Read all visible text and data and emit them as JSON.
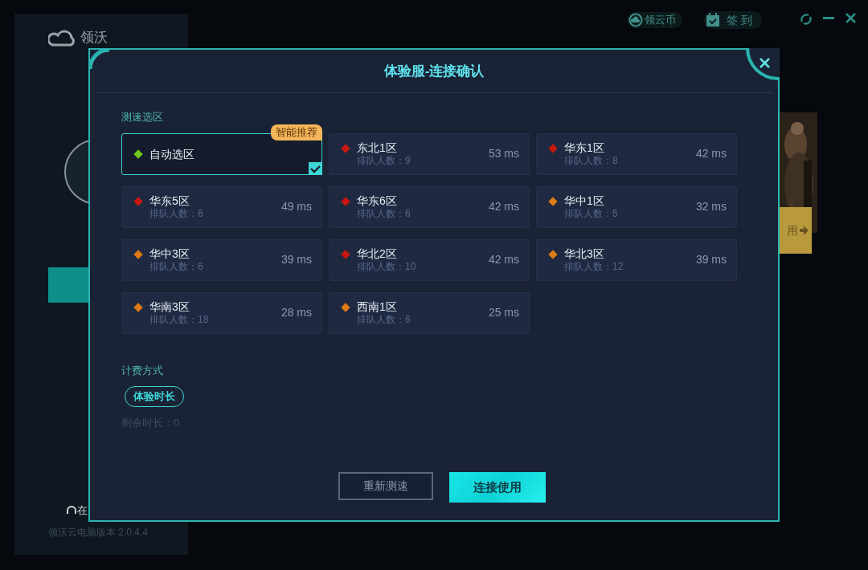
{
  "app": {
    "logo": "领沃",
    "coin_button": "领云币",
    "checkin_button": "签 到",
    "side_button": "用",
    "support_text": "在",
    "version": "领沃云电脑版本 2.0.4.4"
  },
  "dialog": {
    "title": "体验服-连接确认",
    "region_label": "测速选区",
    "regions": [
      {
        "name": "自动选区",
        "color": "#6fc51a",
        "selected": true,
        "badge": "智能推荐"
      },
      {
        "name": "东北1区",
        "queue": "排队人数：9",
        "latency": "53 ms",
        "color": "#c8180e",
        "selected": false
      },
      {
        "name": "华东1区",
        "queue": "排队人数：8",
        "latency": "42 ms",
        "color": "#c8180e",
        "selected": false
      },
      {
        "name": "华东5区",
        "queue": "排队人数：6",
        "latency": "49 ms",
        "color": "#c8180e",
        "selected": false
      },
      {
        "name": "华东6区",
        "queue": "排队人数：6",
        "latency": "42 ms",
        "color": "#c8180e",
        "selected": false
      },
      {
        "name": "华中1区",
        "queue": "排队人数：5",
        "latency": "32 ms",
        "color": "#de7a16",
        "selected": false
      },
      {
        "name": "华中3区",
        "queue": "排队人数：6",
        "latency": "39 ms",
        "color": "#de7a16",
        "selected": false
      },
      {
        "name": "华北2区",
        "queue": "排队人数：10",
        "latency": "42 ms",
        "color": "#c8180e",
        "selected": false
      },
      {
        "name": "华北3区",
        "queue": "排队人数：12",
        "latency": "39 ms",
        "color": "#de7a16",
        "selected": false
      },
      {
        "name": "华南3区",
        "queue": "排队人数：18",
        "latency": "28 ms",
        "color": "#de7a16",
        "selected": false
      },
      {
        "name": "西南1区",
        "queue": "排队人数：6",
        "latency": "25 ms",
        "color": "#de7a16",
        "selected": false
      }
    ],
    "billing_label": "计费方式",
    "billing_options": [
      {
        "label": "体验时长",
        "selected": true
      }
    ],
    "remaining": "剩余时长：0",
    "buttons": [
      {
        "label": "重新测速",
        "kind": "secondary"
      },
      {
        "label": "连接使用",
        "kind": "primary"
      }
    ]
  }
}
